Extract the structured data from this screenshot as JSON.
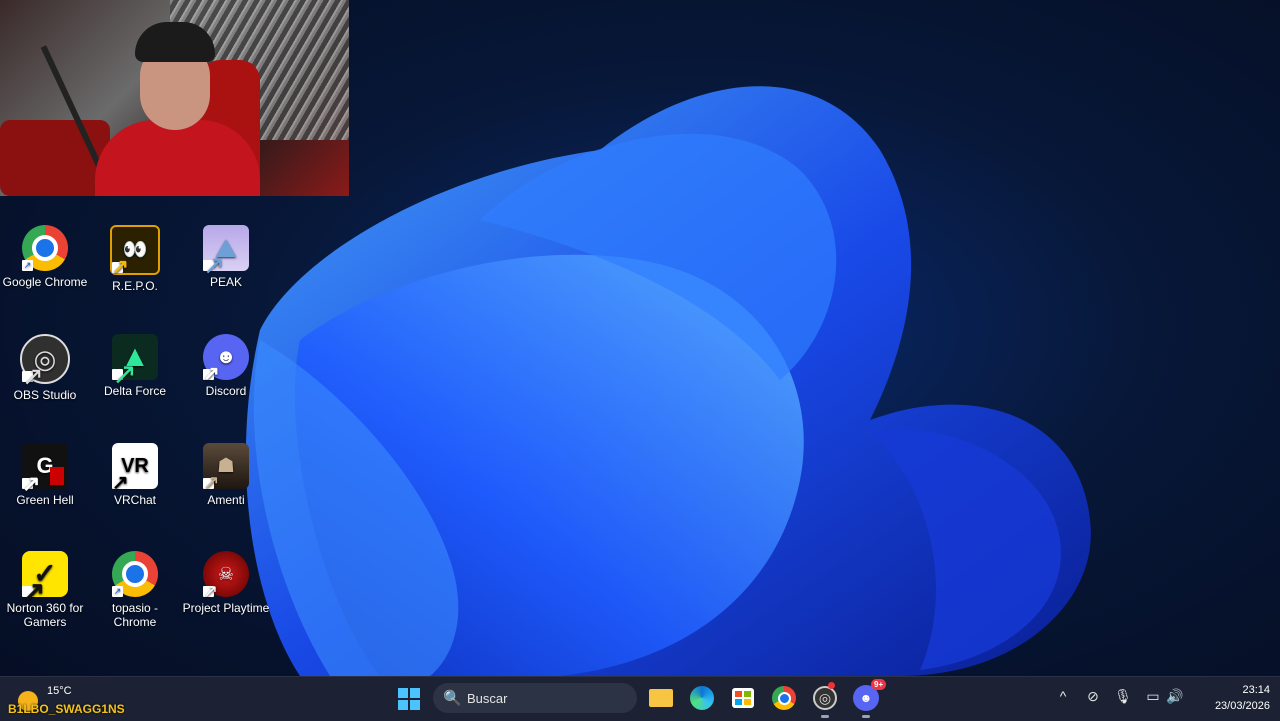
{
  "desktop": {
    "icons": [
      {
        "label": "Google Chrome",
        "glyph": ""
      },
      {
        "label": "R.E.P.O.",
        "glyph": "👀"
      },
      {
        "label": "PEAK",
        "glyph": "⛰"
      },
      {
        "label": "OBS Studio",
        "glyph": "◎"
      },
      {
        "label": "Delta Force",
        "glyph": "▲"
      },
      {
        "label": "Discord",
        "glyph": "☻"
      },
      {
        "label": "Green Hell",
        "glyph": "G"
      },
      {
        "label": "VRChat",
        "glyph": "VR"
      },
      {
        "label": "Amenti",
        "glyph": "☗"
      },
      {
        "label": "Norton 360 for Gamers",
        "glyph": "✓"
      },
      {
        "label": "topasio - Chrome",
        "glyph": ""
      },
      {
        "label": "Project Playtime",
        "glyph": "☠"
      }
    ],
    "shortcut_arrow": "↗"
  },
  "taskbar": {
    "weather": {
      "temperature": "15°C"
    },
    "stream_overlay_name": "B1LBO_SWAGG1NS",
    "search": {
      "placeholder": "Buscar",
      "icon": "🔍"
    },
    "discord_badge": "9+",
    "tray": {
      "chevron": "^",
      "network_off": "⊘",
      "mic": "🎙",
      "display": "▭",
      "volume": "🔊"
    },
    "clock": {
      "time": "23:14",
      "date": "23/03/2026"
    }
  }
}
